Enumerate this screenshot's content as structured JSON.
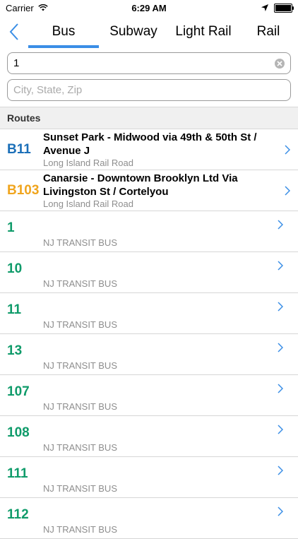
{
  "status": {
    "carrier": "Carrier",
    "time": "6:29 AM"
  },
  "tabs": [
    {
      "label": "Bus",
      "active": true
    },
    {
      "label": "Subway"
    },
    {
      "label": "Light Rail"
    },
    {
      "label": "Rail"
    }
  ],
  "search": {
    "route_value": "1",
    "location_placeholder": "City, State, Zip"
  },
  "section": {
    "title": "Routes"
  },
  "colors": {
    "accent": "#3a8ee6",
    "b11": "#1b6fb8",
    "b103": "#f0a51e",
    "nj": "#0f9b6a"
  },
  "routes": [
    {
      "code": "B11",
      "color": "#1b6fb8",
      "title": "Sunset Park - Midwood via 49th & 50th St / Avenue J",
      "agency": "Long Island Rail Road"
    },
    {
      "code": "B103",
      "color": "#f0a51e",
      "title": "Canarsie - Downtown Brooklyn Ltd Via Livingston St / Cortelyou",
      "agency": "Long Island Rail Road"
    },
    {
      "code": "1",
      "color": "#0f9b6a",
      "agency": "NJ TRANSIT BUS"
    },
    {
      "code": "10",
      "color": "#0f9b6a",
      "agency": "NJ TRANSIT BUS"
    },
    {
      "code": "11",
      "color": "#0f9b6a",
      "agency": "NJ TRANSIT BUS"
    },
    {
      "code": "13",
      "color": "#0f9b6a",
      "agency": "NJ TRANSIT BUS"
    },
    {
      "code": "107",
      "color": "#0f9b6a",
      "agency": "NJ TRANSIT BUS"
    },
    {
      "code": "108",
      "color": "#0f9b6a",
      "agency": "NJ TRANSIT BUS"
    },
    {
      "code": "111",
      "color": "#0f9b6a",
      "agency": "NJ TRANSIT BUS"
    },
    {
      "code": "112",
      "color": "#0f9b6a",
      "agency": "NJ TRANSIT BUS"
    }
  ]
}
